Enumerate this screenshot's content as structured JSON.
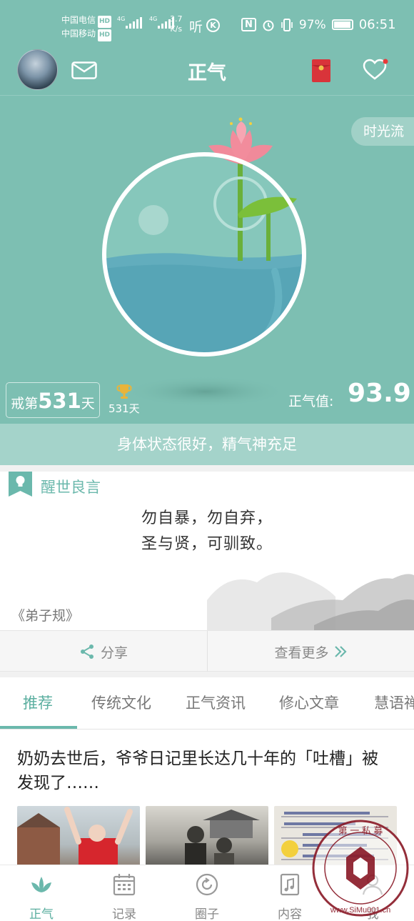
{
  "status_bar": {
    "carrier_1": "中国电信",
    "carrier_2": "中国移动",
    "hd_badge": "HD",
    "network_1": "4G",
    "network_2": "4G",
    "speed_value": "3.7",
    "speed_unit": "K/s",
    "ting_label": "听",
    "k_label": "K",
    "nfc_label": "N",
    "battery_percent": "97%",
    "time": "06:51"
  },
  "header": {
    "title": "正气"
  },
  "hero": {
    "timeline_label": "时光流",
    "streak_prefix": "戒第",
    "streak_days": "531",
    "streak_unit": "天",
    "trophy_days": "531天",
    "score_label": "正气值:",
    "score_value": "93.9",
    "status_message": "身体状态很好，精气神充足"
  },
  "quote": {
    "section_title": "醒世良言",
    "line_1": "勿自暴，勿自弃，",
    "line_2": "圣与贤，可驯致。",
    "source": "《弟子规》",
    "share_label": "分享",
    "more_label": "查看更多"
  },
  "tabs": [
    {
      "label": "推荐",
      "active": true
    },
    {
      "label": "传统文化",
      "active": false
    },
    {
      "label": "正气资讯",
      "active": false
    },
    {
      "label": "修心文章",
      "active": false
    },
    {
      "label": "慧语禅",
      "active": false
    }
  ],
  "article": {
    "title": "奶奶去世后，爷爷日记里长达几十年的「吐槽」被发现了……"
  },
  "bottom_nav": [
    {
      "label": "正气",
      "icon": "lotus-icon",
      "active": true
    },
    {
      "label": "记录",
      "icon": "calendar-icon",
      "active": false
    },
    {
      "label": "圈子",
      "icon": "circle-refresh-icon",
      "active": false
    },
    {
      "label": "内容",
      "icon": "music-note-icon",
      "active": false
    },
    {
      "label": "我",
      "icon": "person-icon",
      "active": false
    }
  ],
  "watermark": {
    "top_text": "第 一 私 募",
    "bottom_text": "www.SiMu001.cn"
  },
  "colors": {
    "teal": "#7dbfb2",
    "teal_light": "#a4d3ca",
    "accent": "#5aae9f",
    "lotus_pink": "#f08a9a",
    "leaf_green": "#7bbf3a",
    "watermark_red": "#8c1d2a"
  }
}
